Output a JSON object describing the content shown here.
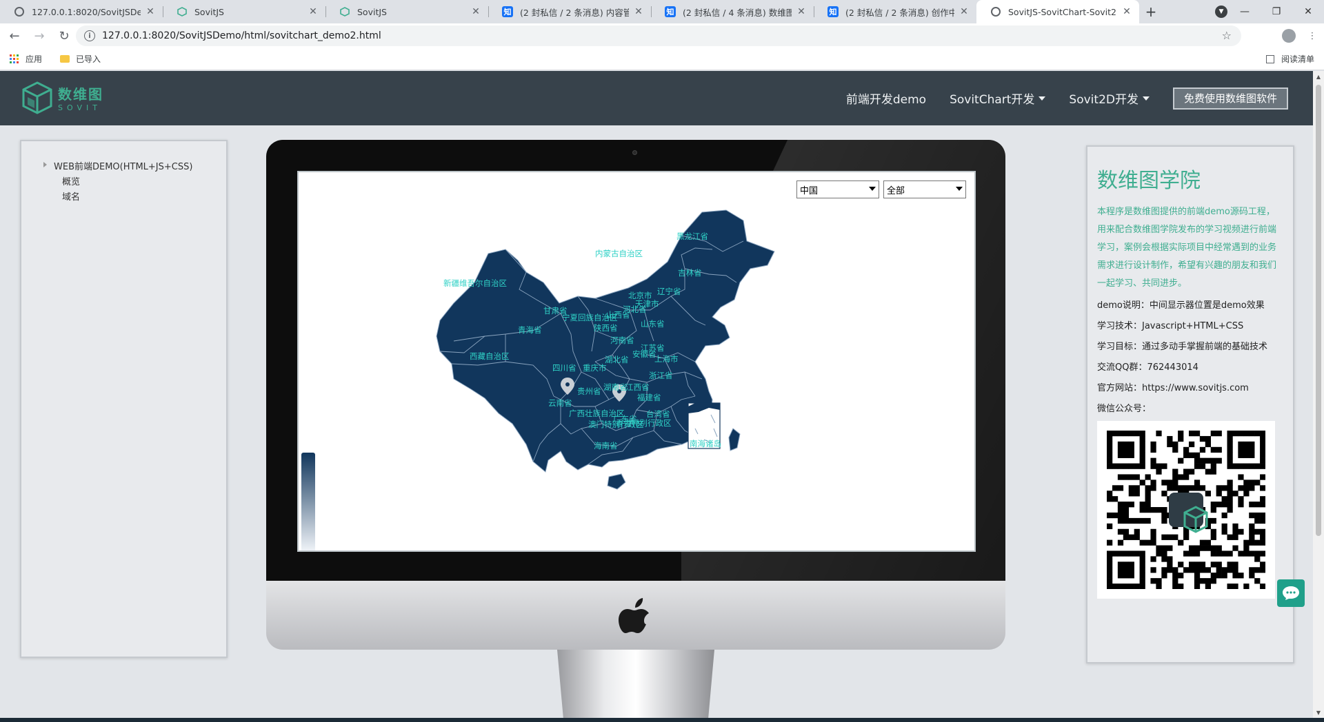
{
  "browser": {
    "tabs": [
      {
        "title": "127.0.0.1:8020/SovitJSDemo/",
        "icon": "globe-icon",
        "active": false
      },
      {
        "title": "SovitJS",
        "icon": "sovit-icon",
        "active": false
      },
      {
        "title": "SovitJS",
        "icon": "sovit-icon",
        "active": false
      },
      {
        "title": "(2 封私信 / 2 条消息) 内容管理",
        "icon": "zhihu-icon",
        "active": false
      },
      {
        "title": "(2 封私信 / 4 条消息) 数维图 - ",
        "icon": "zhihu-icon",
        "active": false
      },
      {
        "title": "(2 封私信 / 2 条消息) 创作中心",
        "icon": "zhihu-icon",
        "active": false
      },
      {
        "title": "SovitJS-SovitChart-Sovit2D",
        "icon": "globe-icon",
        "active": true
      }
    ],
    "new_tab": "+",
    "url": "127.0.0.1:8020/SovitJSDemo/html/sovitchart_demo2.html",
    "bookmarks": {
      "apps": "应用",
      "imported": "已导入",
      "reading_list": "阅读清单"
    },
    "zhihu_glyph": "知"
  },
  "navbar": {
    "logo_cn": "数维图",
    "logo_en": "SOVIT",
    "links": [
      {
        "label": "前端开发demo",
        "dropdown": false
      },
      {
        "label": "SovitChart开发",
        "dropdown": true
      },
      {
        "label": "Sovit2D开发",
        "dropdown": true
      }
    ],
    "cta": "免费使用数维图软件"
  },
  "sidebar": {
    "root": "WEB前端DEMO(HTML+JS+CSS)",
    "children": [
      "概览",
      "域名"
    ]
  },
  "map": {
    "country_select": "中国",
    "region_select": "全部",
    "colors": {
      "land": "#11365c",
      "border": "#8aa4bf",
      "label": "#2fd1c6"
    },
    "provinces": [
      "黑龙江省",
      "内蒙古自治区",
      "吉林省",
      "新疆维吾尔自治区",
      "辽宁省",
      "北京市",
      "天津市",
      "河北省",
      "甘肃省",
      "宁夏回族自治区",
      "山西省",
      "山东省",
      "青海省",
      "陕西省",
      "河南省",
      "江苏省",
      "安徽省",
      "上海市",
      "西藏自治区",
      "四川省",
      "重庆市",
      "湖北省",
      "浙江省",
      "贵州省",
      "湖南省",
      "江西省",
      "福建省",
      "云南省",
      "广西壮族自治区",
      "广东省",
      "台湾省",
      "澳门特别行政区",
      "香港特别行政区",
      "海南省",
      "南海诸岛"
    ]
  },
  "right_panel": {
    "title": "数维图学院",
    "intro": "本程序是数维图提供的前端demo源码工程，用来配合数维图学院发布的学习视频进行前端学习，案例会根据实际项目中经常遇到的业务需求进行设计制作，希望有兴趣的朋友和我们一起学习、共同进步。",
    "lines": [
      "demo说明：中间显示器位置是demo效果",
      "学习技术：Javascript+HTML+CSS",
      "学习目标：通过多动手掌握前端的基础技术",
      "交流QQ群：762443014",
      "官方网站：https://www.sovitjs.com",
      "微信公众号："
    ]
  }
}
